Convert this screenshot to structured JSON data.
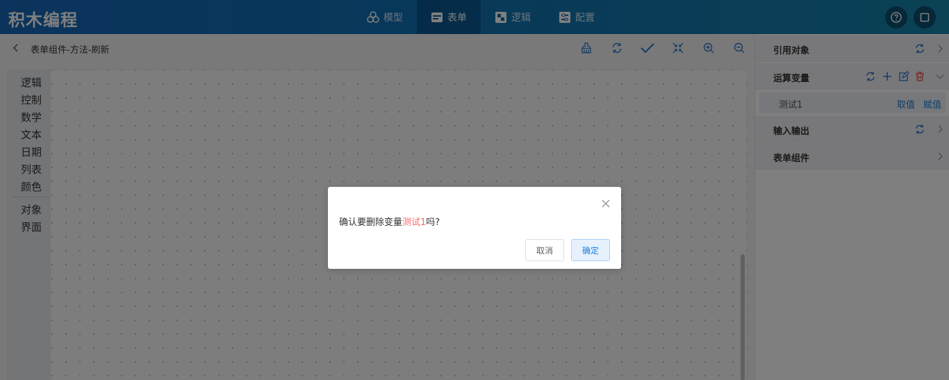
{
  "app": {
    "title": "积木编程"
  },
  "nav": [
    {
      "label": "模型",
      "icon": "cube-cluster-icon",
      "active": false
    },
    {
      "label": "表单",
      "icon": "form-icon",
      "active": true
    },
    {
      "label": "逻辑",
      "icon": "puzzle-icon",
      "active": false
    },
    {
      "label": "配置",
      "icon": "config-icon",
      "active": false
    }
  ],
  "toolbar": {
    "breadcrumb": "表单组件-方法-刷新",
    "icons": [
      "clean-icon",
      "refresh-icon",
      "check-icon",
      "collapse-icon",
      "zoom-in-icon",
      "zoom-out-icon"
    ]
  },
  "toolbox": {
    "categories": [
      "逻辑",
      "控制",
      "数学",
      "文本",
      "日期",
      "列表",
      "颜色"
    ],
    "categories2": [
      "对象",
      "界面"
    ]
  },
  "panel": {
    "ref_objects": "引用对象",
    "calc_vars": "运算变量",
    "variable": {
      "name": "测试1",
      "get_label": "取值",
      "set_label": "赋值"
    },
    "io": "输入输出",
    "form_components": "表单组件"
  },
  "dialog": {
    "message_prefix": "确认要删除变量",
    "var_name": "测试1",
    "message_suffix": "吗?",
    "cancel_label": "取消",
    "ok_label": "确定"
  },
  "colors": {
    "accent": "#1e7fd8",
    "danger": "#f56c6c",
    "topbar": "#1667b6"
  }
}
